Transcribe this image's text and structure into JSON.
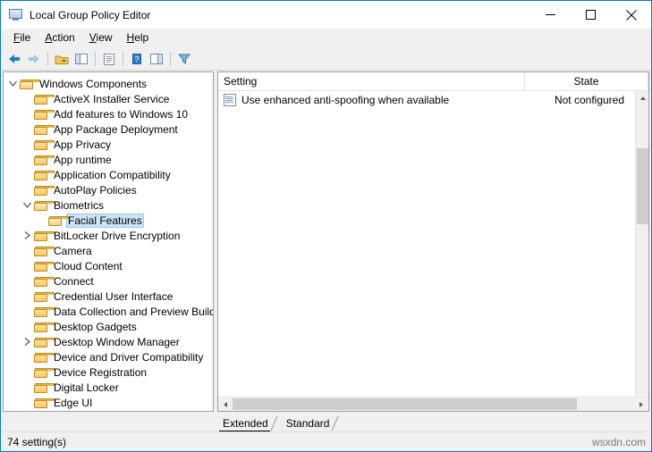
{
  "window": {
    "title": "Local Group Policy Editor",
    "icon": "group-policy-icon",
    "minimize_label": "–",
    "maximize_label": "☐",
    "close_label": "✕"
  },
  "menu": [
    {
      "label": "File",
      "mnemonic": "F"
    },
    {
      "label": "Action",
      "mnemonic": "A"
    },
    {
      "label": "View",
      "mnemonic": "V"
    },
    {
      "label": "Help",
      "mnemonic": "H"
    }
  ],
  "toolbar": [
    {
      "name": "back-button",
      "glyph": "◀"
    },
    {
      "name": "forward-button",
      "glyph": "▶"
    },
    {
      "name": "up-one-level-button",
      "glyph": "folder-up"
    },
    {
      "name": "show-hide-console-tree-button",
      "glyph": "tree-pane"
    },
    {
      "name": "export-list-button",
      "glyph": "export-list"
    },
    {
      "name": "help-button",
      "glyph": "help"
    },
    {
      "name": "show-hide-action-pane-button",
      "glyph": "action-pane"
    },
    {
      "name": "filter-button",
      "glyph": "filter"
    }
  ],
  "tree": {
    "items": [
      {
        "label": "Windows Components",
        "depth": 0,
        "twisty": "expanded",
        "folder": "open",
        "selected": false
      },
      {
        "label": "ActiveX Installer Service",
        "depth": 1,
        "twisty": "none",
        "folder": "closed",
        "selected": false
      },
      {
        "label": "Add features to Windows 10",
        "depth": 1,
        "twisty": "none",
        "folder": "closed",
        "selected": false
      },
      {
        "label": "App Package Deployment",
        "depth": 1,
        "twisty": "none",
        "folder": "closed",
        "selected": false
      },
      {
        "label": "App Privacy",
        "depth": 1,
        "twisty": "none",
        "folder": "closed",
        "selected": false
      },
      {
        "label": "App runtime",
        "depth": 1,
        "twisty": "none",
        "folder": "closed",
        "selected": false
      },
      {
        "label": "Application Compatibility",
        "depth": 1,
        "twisty": "none",
        "folder": "closed",
        "selected": false
      },
      {
        "label": "AutoPlay Policies",
        "depth": 1,
        "twisty": "none",
        "folder": "closed",
        "selected": false
      },
      {
        "label": "Biometrics",
        "depth": 1,
        "twisty": "expanded",
        "folder": "open",
        "selected": false
      },
      {
        "label": "Facial Features",
        "depth": 2,
        "twisty": "none",
        "folder": "open",
        "selected": true
      },
      {
        "label": "BitLocker Drive Encryption",
        "depth": 1,
        "twisty": "collapsed",
        "folder": "closed",
        "selected": false
      },
      {
        "label": "Camera",
        "depth": 1,
        "twisty": "none",
        "folder": "closed",
        "selected": false
      },
      {
        "label": "Cloud Content",
        "depth": 1,
        "twisty": "none",
        "folder": "closed",
        "selected": false
      },
      {
        "label": "Connect",
        "depth": 1,
        "twisty": "none",
        "folder": "closed",
        "selected": false
      },
      {
        "label": "Credential User Interface",
        "depth": 1,
        "twisty": "none",
        "folder": "closed",
        "selected": false
      },
      {
        "label": "Data Collection and Preview Build",
        "depth": 1,
        "twisty": "none",
        "folder": "closed",
        "selected": false
      },
      {
        "label": "Desktop Gadgets",
        "depth": 1,
        "twisty": "none",
        "folder": "closed",
        "selected": false
      },
      {
        "label": "Desktop Window Manager",
        "depth": 1,
        "twisty": "collapsed",
        "folder": "closed",
        "selected": false
      },
      {
        "label": "Device and Driver Compatibility",
        "depth": 1,
        "twisty": "none",
        "folder": "closed",
        "selected": false
      },
      {
        "label": "Device Registration",
        "depth": 1,
        "twisty": "none",
        "folder": "closed",
        "selected": false
      },
      {
        "label": "Digital Locker",
        "depth": 1,
        "twisty": "none",
        "folder": "closed",
        "selected": false
      },
      {
        "label": "Edge UI",
        "depth": 1,
        "twisty": "none",
        "folder": "closed",
        "selected": false
      }
    ]
  },
  "list": {
    "columns": [
      {
        "label": "Setting"
      },
      {
        "label": "State"
      }
    ],
    "rows": [
      {
        "setting": "Use enhanced anti-spoofing when available",
        "state": "Not configured",
        "icon": "policy-setting-icon"
      }
    ]
  },
  "tabs": [
    {
      "label": "Extended",
      "active": true
    },
    {
      "label": "Standard",
      "active": false
    }
  ],
  "status": {
    "text": "74 setting(s)",
    "watermark": "wsxdn.com"
  },
  "colors": {
    "accent": "#0a7cc0",
    "selection": "#cce3f5",
    "folder": "#f5c761",
    "window_bg": "#f0f0f0",
    "pane_bg": "#ffffff"
  }
}
